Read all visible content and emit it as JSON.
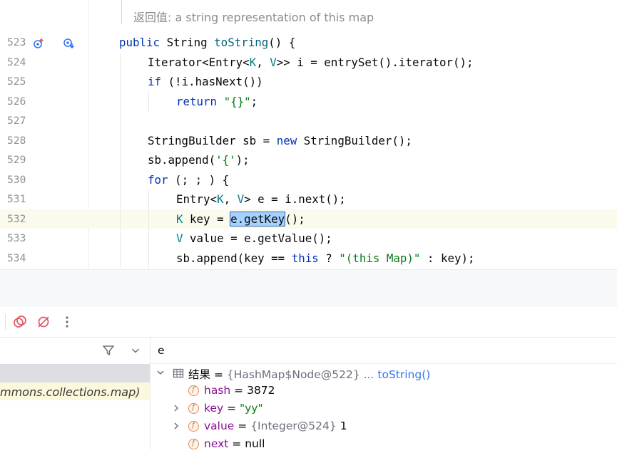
{
  "editor": {
    "doc_hint": "返回值: a string representation of this map",
    "lines": [
      {
        "num": "523"
      },
      {
        "num": "524"
      },
      {
        "num": "525"
      },
      {
        "num": "526"
      },
      {
        "num": "527"
      },
      {
        "num": "528"
      },
      {
        "num": "529"
      },
      {
        "num": "530"
      },
      {
        "num": "531"
      },
      {
        "num": "532"
      },
      {
        "num": "533"
      },
      {
        "num": "534"
      }
    ],
    "code": {
      "l523": [
        "public",
        " String ",
        "toString",
        "() {"
      ],
      "l524": [
        "Iterator<Entry<",
        "K",
        ", ",
        "V",
        ">> i = entrySet().iterator();"
      ],
      "l525": [
        "if",
        " (!i.hasNext())"
      ],
      "l526": [
        "return",
        " ",
        "\"{}\"",
        ";"
      ],
      "l528": [
        "StringBuilder sb = ",
        "new",
        " StringBuilder();"
      ],
      "l529": [
        "sb.append(",
        "'{'",
        ");"
      ],
      "l530": [
        "for",
        " (; ; ) {"
      ],
      "l531": [
        "Entry<",
        "K",
        ", ",
        "V",
        "> e = i.next();"
      ],
      "l532": [
        "K",
        " key = ",
        "e.getKey",
        "();"
      ],
      "l533": [
        "V",
        " value = e.getValue();"
      ],
      "l534": [
        "sb.append(key == ",
        "this",
        " ? ",
        "\"(this Map)\"",
        " : key);"
      ]
    },
    "gutter_icons": [
      "override-up-icon",
      "implementation-down-icon"
    ]
  },
  "debugger": {
    "frames_filter_icon": "filter-icon",
    "frames_dropdown_icon": "chevron-down-icon",
    "frames": [
      {
        "text": "",
        "selected": true
      },
      {
        "text": "mmons.collections.map)",
        "library": true
      }
    ],
    "eval_expression": "e",
    "variables": {
      "result": {
        "name": "结果",
        "eq": " = ",
        "ref": "{HashMap$Node@522}",
        "link": "... toString()"
      },
      "hash": {
        "name": "hash",
        "eq": " = ",
        "value": "3872"
      },
      "key": {
        "name": "key",
        "eq": " = ",
        "value": "\"yy\""
      },
      "value": {
        "name": "value",
        "eq": " = ",
        "ref": "{Integer@524}",
        "value": " 1"
      },
      "next": {
        "name": "next",
        "eq": " = ",
        "value": "null"
      }
    }
  }
}
